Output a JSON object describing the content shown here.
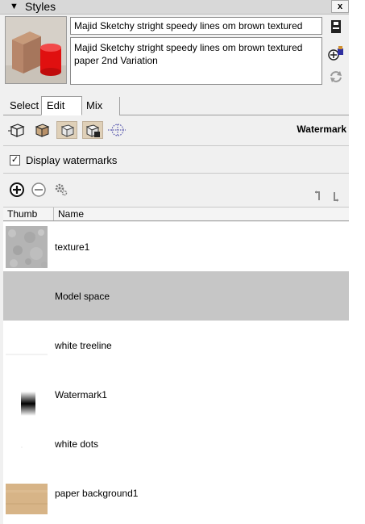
{
  "panel": {
    "title": "Styles",
    "collapse_icon": "triangle-down-icon",
    "close_label": "x"
  },
  "style": {
    "name": "Majid Sketchy stright speedy lines om brown textured",
    "description": "Majid Sketchy stright speedy lines om brown textured paper 2nd Variation"
  },
  "tabs": [
    {
      "label": "Select"
    },
    {
      "label": "Edit"
    },
    {
      "label": "Mix"
    }
  ],
  "edit_section": {
    "label": "Watermark"
  },
  "display_watermarks": {
    "label": "Display watermarks",
    "checked": true,
    "mark": "✓"
  },
  "list": {
    "columns": [
      "Thumb",
      "Name"
    ],
    "items": [
      {
        "name": "texture1",
        "thumb": "gray-texture"
      },
      {
        "name": "Model space",
        "thumb": "none",
        "selected": true
      },
      {
        "name": "white treeline",
        "thumb": "white-treeline"
      },
      {
        "name": "Watermark1",
        "thumb": "black-gradient"
      },
      {
        "name": "white dots",
        "thumb": "white-dots"
      },
      {
        "name": "paper background1",
        "thumb": "brown-paper"
      }
    ]
  },
  "colors": {
    "selected_row": "#c6c6c6",
    "active_mode": "#dfd0b8",
    "accent_red": "#e01010"
  }
}
